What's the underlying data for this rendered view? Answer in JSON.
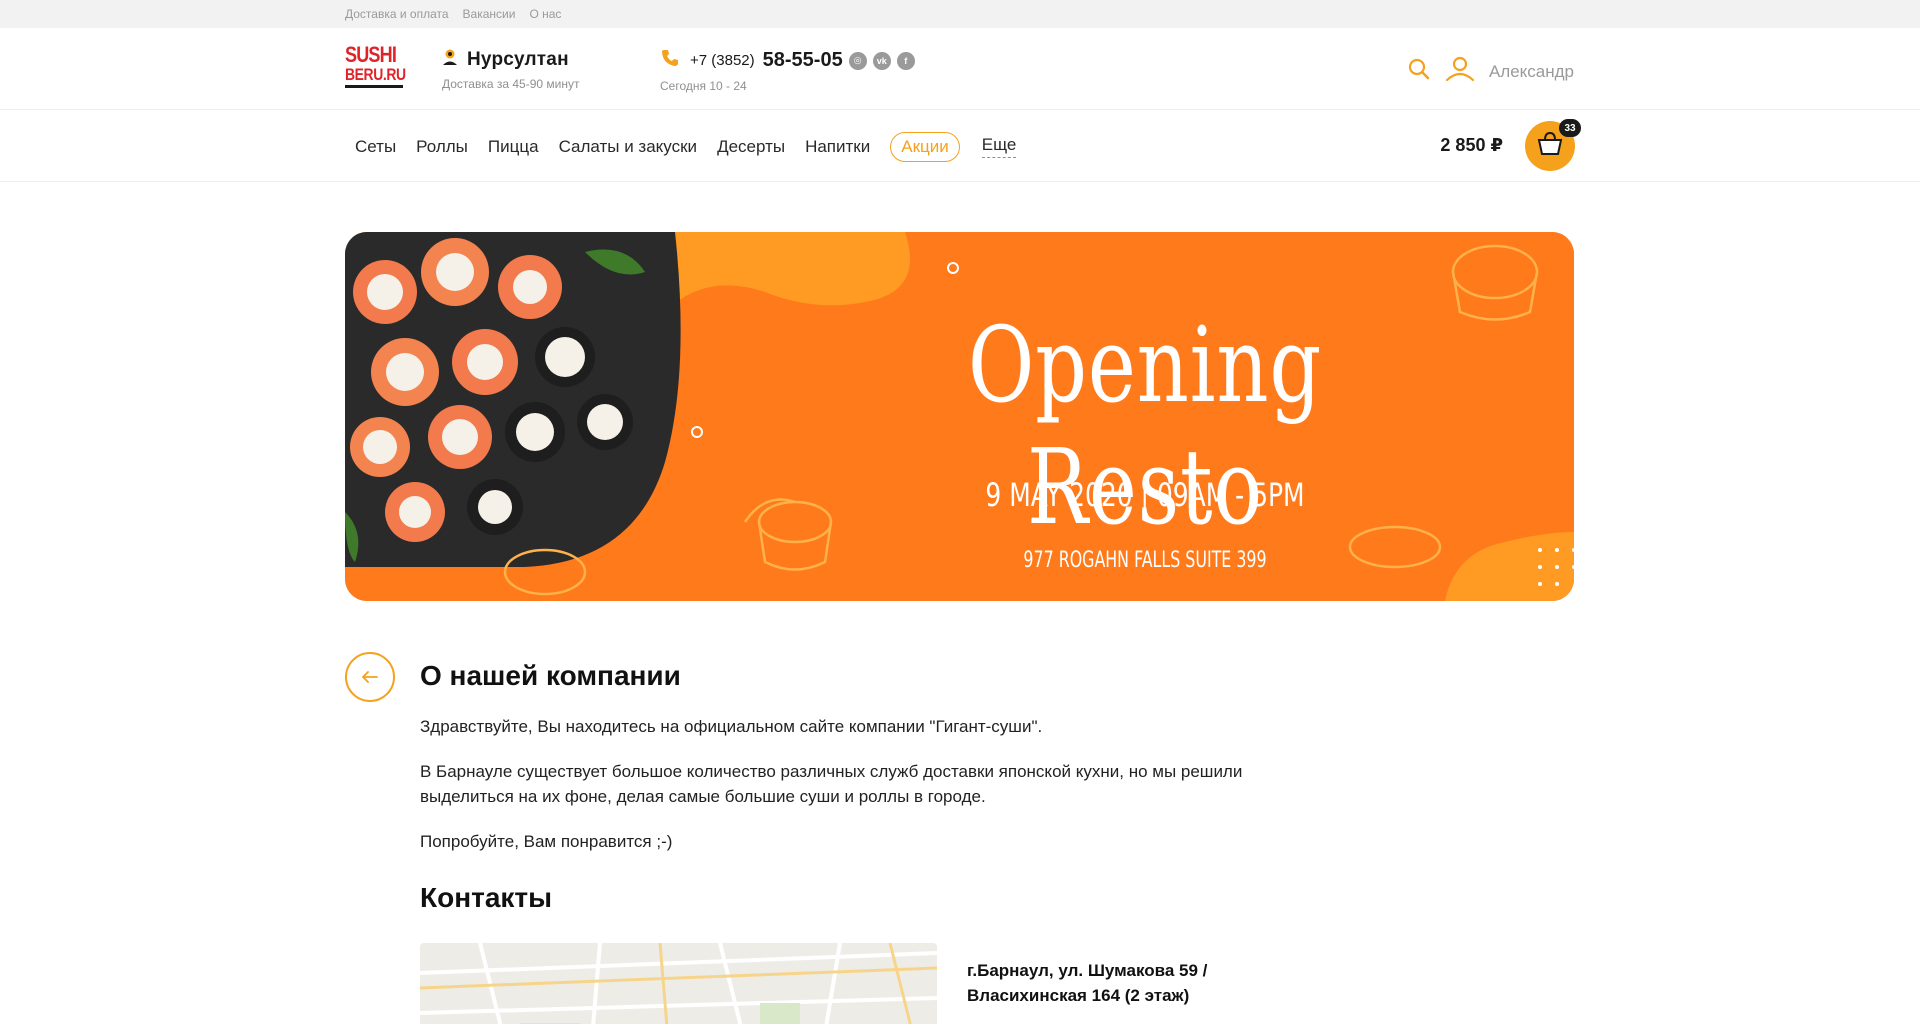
{
  "topbar": {
    "links": [
      "Доставка и оплата",
      "Вакансии",
      "О нас"
    ]
  },
  "header": {
    "logo": {
      "line1": "SUSHI",
      "line2": "BERU.RU"
    },
    "city": {
      "name": "Нурсултан",
      "delivery": "Доставка за 45-90 минут"
    },
    "phone": {
      "prefix": "+7 (3852)",
      "number": "58-55-05",
      "hours": "Сегодня 10 - 24"
    },
    "user_name": "Александр"
  },
  "nav": {
    "items": [
      "Сеты",
      "Роллы",
      "Пицца",
      "Салаты и закуски",
      "Десерты",
      "Напитки"
    ],
    "promo": "Акции",
    "more": "Еще",
    "cart_sum": "2 850 ₽",
    "cart_count": "33"
  },
  "banner": {
    "title": "Opening Resto",
    "date": "9 MAY 2020 | 09AM - 5PM",
    "address": "977 ROGAHN FALLS SUITE 399"
  },
  "content": {
    "title": "О нашей компании",
    "paragraphs": [
      "Здравствуйте, Вы находитесь на официальном сайте компании \"Гигант-суши\".",
      "В Барнауле существует большое количество различных служб доставки японской кухни, но мы решили выделиться на их фоне, делая самые большие суши и роллы в городе.",
      "Попробуйте, Вам понравится ;-)"
    ],
    "contacts_title": "Контакты",
    "address": "г.Барнаул, ул. Шумакова 59 / Власихинская 164 (2 этаж)"
  },
  "colors": {
    "accent": "#f5a11c",
    "brand": "#e02329",
    "banner_bg": "#ff7a1a"
  },
  "icons": [
    "location-pin-icon",
    "phone-icon",
    "instagram-icon",
    "vk-icon",
    "facebook-icon",
    "search-icon",
    "user-icon",
    "cart-icon",
    "back-arrow-icon"
  ]
}
